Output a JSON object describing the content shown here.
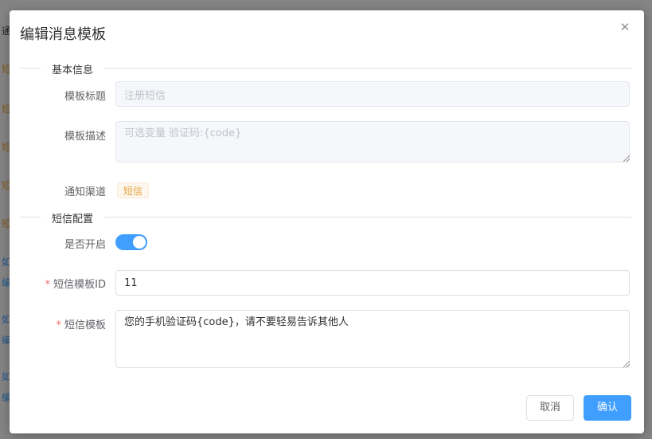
{
  "background": {
    "glyphs": [
      {
        "text": "通",
        "color": "#333333"
      },
      {
        "text": "短",
        "color": "#e6a23c"
      },
      {
        "text": "短",
        "color": "#e6a23c"
      },
      {
        "text": "短",
        "color": "#e6a23c"
      },
      {
        "text": "短",
        "color": "#e6a23c"
      },
      {
        "text": "短",
        "color": "#e6a23c"
      },
      {
        "text": "如",
        "color": "#409eff"
      },
      {
        "text": "编",
        "color": "#409eff"
      },
      {
        "text": "如",
        "color": "#409eff"
      },
      {
        "text": "编",
        "color": "#409eff"
      },
      {
        "text": "如",
        "color": "#409eff"
      },
      {
        "text": "编",
        "color": "#409eff"
      }
    ]
  },
  "dialog": {
    "title": "编辑消息模板",
    "close_icon": "close-icon",
    "sections": {
      "basic": "基本信息",
      "sms": "短信配置"
    },
    "fields": {
      "template_title": {
        "label": "模板标题",
        "value": "注册短信"
      },
      "template_desc": {
        "label": "模板描述",
        "value": "可选变量 验证码:{code}"
      },
      "channel": {
        "label": "通知渠道",
        "tag": "短信"
      },
      "enabled": {
        "label": "是否开启",
        "checked": true
      },
      "sms_template_id": {
        "label": "短信模板ID",
        "value": "11",
        "required_mark": "*"
      },
      "sms_template": {
        "label": "短信模板",
        "value": "您的手机验证码{code}，请不要轻易告诉其他人",
        "required_mark": "*"
      }
    },
    "footer": {
      "cancel": "取消",
      "confirm": "确认"
    },
    "colors": {
      "primary": "#409eff",
      "warning": "#e6a23c",
      "danger": "#f56c6c"
    }
  }
}
